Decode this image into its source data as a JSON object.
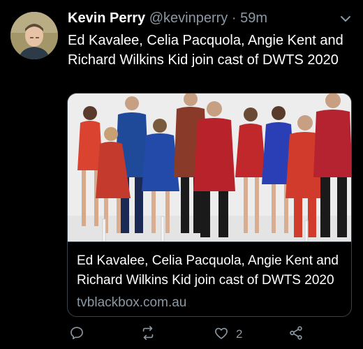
{
  "tweet": {
    "author_name": "Kevin Perry",
    "author_handle": "@kevinperry",
    "separator": "·",
    "time": "59m",
    "text": "Ed Kavalee, Celia Pacquola, Angie Kent and Richard Wilkins Kid join cast of DWTS 2020",
    "avatar_icon": "profile-photo",
    "menu_icon": "chevron-down-icon"
  },
  "card": {
    "image_description_icon": "cast-photo",
    "title": "Ed Kavalee, Celia Pacquola, Angie Kent and Richard Wilkins Kid join cast of DWTS 2020",
    "domain": "tvblackbox.com.au"
  },
  "actions": {
    "reply_icon": "reply-icon",
    "retweet_icon": "retweet-icon",
    "like_icon": "heart-icon",
    "like_count": "2",
    "share_icon": "share-icon"
  },
  "colors": {
    "background": "#000000",
    "text": "#ffffff",
    "secondary": "#8b98a5",
    "border": "#38444d"
  }
}
